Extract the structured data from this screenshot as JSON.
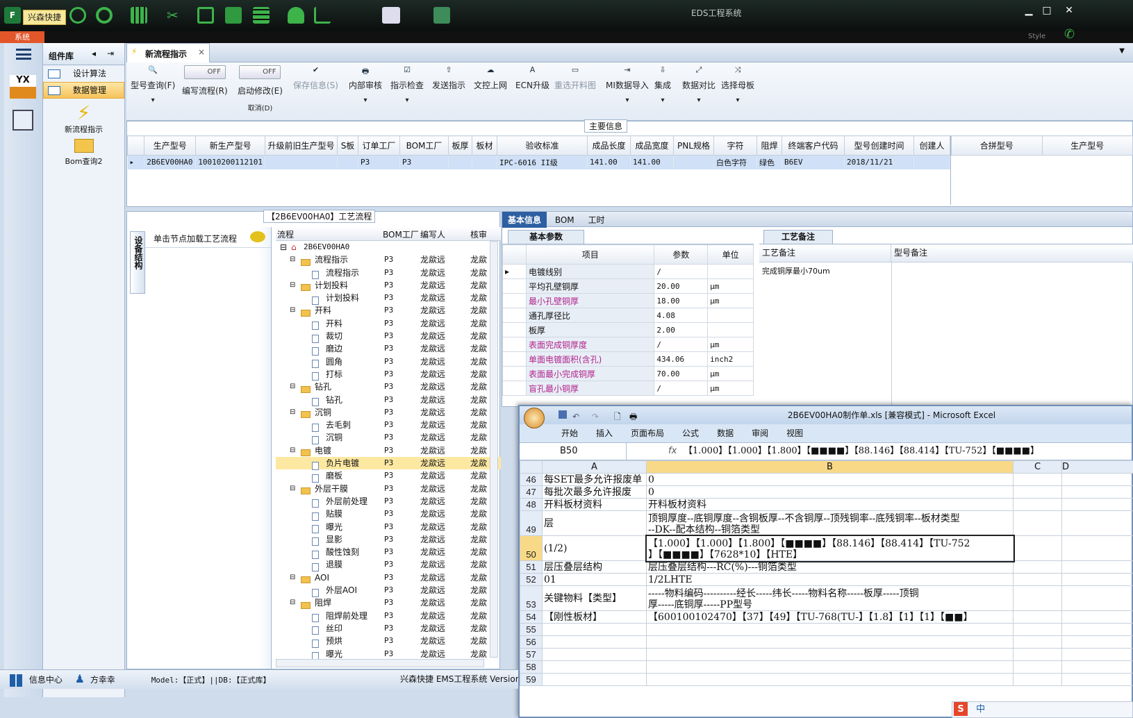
{
  "app": {
    "quick_label": "兴森快捷",
    "title": "EDS工程系统",
    "sys_tab": "系统",
    "style_label": "Style"
  },
  "complib": {
    "title": "组件库",
    "items": [
      {
        "label": "设计算法"
      },
      {
        "label": "数据管理"
      }
    ],
    "big": [
      {
        "label": "新流程指示"
      },
      {
        "label": "Bom查询2"
      }
    ]
  },
  "nav": {
    "yx": "YX"
  },
  "tab": {
    "label": "新流程指示",
    "close": "×"
  },
  "toolbar": {
    "items": [
      {
        "icon": "🔍",
        "label": "型号查询(F)",
        "sub": "▾"
      },
      {
        "label": "编写流程(R)",
        "toggle": "OFF"
      },
      {
        "label": "启动修改(E)",
        "toggle": "OFF",
        "sub": "取消(D)"
      },
      {
        "icon": "✔",
        "label": "保存信息(S)",
        "dis": true
      },
      {
        "icon": "🖶",
        "label": "内部审核",
        "sub": "▾"
      },
      {
        "icon": "☑",
        "label": "指示检查",
        "sub": "▾"
      },
      {
        "icon": "⇧",
        "label": "发送指示"
      },
      {
        "icon": "☁",
        "label": "文控上网"
      },
      {
        "icon": "A",
        "label": "ECN升级"
      },
      {
        "icon": "▭",
        "label": "重选开料图",
        "dis": true
      },
      {
        "icon": "⇥",
        "label": "MI数据导入",
        "sub": "▾"
      },
      {
        "icon": "⇩",
        "label": "集成",
        "sub": "▾"
      },
      {
        "icon": "⤢",
        "label": "数据对比",
        "sub": "▾"
      },
      {
        "icon": "⤨",
        "label": "选择母板",
        "sub": "▾"
      }
    ]
  },
  "main_info": {
    "title": "主要信息",
    "columns": [
      "生产型号",
      "新生产型号",
      "升级前旧生产型号",
      "S板",
      "订单工厂",
      "BOM工厂",
      "板厚",
      "板材",
      "验收标准",
      "成品长度",
      "成品宽度",
      "PNL规格",
      "字符",
      "阻焊",
      "终端客户代码",
      "型号创建时间",
      "创建人"
    ],
    "row": [
      "2B6EV00HA0",
      "10010200112101",
      "",
      "",
      "P3",
      "P3",
      "",
      "",
      "IPC-6016 II级",
      "141.00",
      "141.00",
      "",
      "白色字符",
      "绿色",
      "B6EV",
      "2018/11/21",
      ""
    ],
    "side_columns": [
      "合拼型号",
      "生产型号"
    ]
  },
  "process": {
    "title": "【2B6EV00HA0】工艺流程",
    "vtab": "设备结构",
    "hint": "单击节点加载工艺流程",
    "cols": [
      "流程",
      "BOM工厂",
      "编写人",
      "核审"
    ],
    "root": "2B6EV00HA0",
    "rows": [
      {
        "n": "流程指示",
        "l": 1,
        "f": true,
        "b": "P3",
        "w": "龙歘远",
        "h": "龙歘"
      },
      {
        "n": "流程指示",
        "l": 2,
        "b": "P3",
        "w": "龙歘远",
        "h": "龙歘"
      },
      {
        "n": "计划投料",
        "l": 1,
        "f": true,
        "b": "P3",
        "w": "龙歘远",
        "h": "龙歘"
      },
      {
        "n": "计划投料",
        "l": 2,
        "b": "P3",
        "w": "龙歘远",
        "h": "龙歘"
      },
      {
        "n": "开料",
        "l": 1,
        "f": true,
        "b": "P3",
        "w": "龙歘远",
        "h": "龙歘"
      },
      {
        "n": "开料",
        "l": 2,
        "b": "P3",
        "w": "龙歘远",
        "h": "龙歘"
      },
      {
        "n": "裁切",
        "l": 2,
        "b": "P3",
        "w": "龙歘远",
        "h": "龙歘"
      },
      {
        "n": "磨边",
        "l": 2,
        "b": "P3",
        "w": "龙歘远",
        "h": "龙歘"
      },
      {
        "n": "圆角",
        "l": 2,
        "b": "P3",
        "w": "龙歘远",
        "h": "龙歘"
      },
      {
        "n": "打标",
        "l": 2,
        "b": "P3",
        "w": "龙歘远",
        "h": "龙歘"
      },
      {
        "n": "钻孔",
        "l": 1,
        "f": true,
        "b": "P3",
        "w": "龙歘远",
        "h": "龙歘"
      },
      {
        "n": "钻孔",
        "l": 2,
        "b": "P3",
        "w": "龙歘远",
        "h": "龙歘"
      },
      {
        "n": "沉铜",
        "l": 1,
        "f": true,
        "b": "P3",
        "w": "龙歘远",
        "h": "龙歘"
      },
      {
        "n": "去毛刺",
        "l": 2,
        "b": "P3",
        "w": "龙歘远",
        "h": "龙歘"
      },
      {
        "n": "沉铜",
        "l": 2,
        "b": "P3",
        "w": "龙歘远",
        "h": "龙歘"
      },
      {
        "n": "电镀",
        "l": 1,
        "f": true,
        "b": "P3",
        "w": "龙歘远",
        "h": "龙歘"
      },
      {
        "n": "负片电镀",
        "l": 2,
        "b": "P3",
        "w": "龙歘远",
        "h": "龙歘",
        "sel": true
      },
      {
        "n": "磨板",
        "l": 2,
        "b": "P3",
        "w": "龙歘远",
        "h": "龙歘"
      },
      {
        "n": "外层干膜",
        "l": 1,
        "f": true,
        "b": "P3",
        "w": "龙歘远",
        "h": "龙歘"
      },
      {
        "n": "外层前处理",
        "l": 2,
        "b": "P3",
        "w": "龙歘远",
        "h": "龙歘"
      },
      {
        "n": "贴膜",
        "l": 2,
        "b": "P3",
        "w": "龙歘远",
        "h": "龙歘"
      },
      {
        "n": "曝光",
        "l": 2,
        "b": "P3",
        "w": "龙歘远",
        "h": "龙歘"
      },
      {
        "n": "显影",
        "l": 2,
        "b": "P3",
        "w": "龙歘远",
        "h": "龙歘"
      },
      {
        "n": "酸性蚀刻",
        "l": 2,
        "b": "P3",
        "w": "龙歘远",
        "h": "龙歘"
      },
      {
        "n": "退膜",
        "l": 2,
        "b": "P3",
        "w": "龙歘远",
        "h": "龙歘"
      },
      {
        "n": "AOI",
        "l": 1,
        "f": true,
        "b": "P3",
        "w": "龙歘远",
        "h": "龙歘"
      },
      {
        "n": "外层AOI",
        "l": 2,
        "b": "P3",
        "w": "龙歘远",
        "h": "龙歘"
      },
      {
        "n": "阻焊",
        "l": 1,
        "f": true,
        "b": "P3",
        "w": "龙歘远",
        "h": "龙歘"
      },
      {
        "n": "阻焊前处理",
        "l": 2,
        "b": "P3",
        "w": "龙歘远",
        "h": "龙歘"
      },
      {
        "n": "丝印",
        "l": 2,
        "b": "P3",
        "w": "龙歘远",
        "h": "龙歘"
      },
      {
        "n": "预烘",
        "l": 2,
        "b": "P3",
        "w": "龙歘远",
        "h": "龙歘"
      },
      {
        "n": "曝光",
        "l": 2,
        "b": "P3",
        "w": "龙歘远",
        "h": "龙歘"
      }
    ]
  },
  "basic": {
    "tabs": [
      "基本信息",
      "BOM",
      "工时"
    ],
    "sub": "基本参数",
    "notes_tab": "工艺备注",
    "cols": [
      "项目",
      "参数",
      "单位"
    ],
    "rows": [
      {
        "k": "电镀线别",
        "v": "/",
        "u": "",
        "pink": false
      },
      {
        "k": "平均孔壁铜厚",
        "v": "20.00",
        "u": "μm",
        "pink": false
      },
      {
        "k": "最小孔壁铜厚",
        "v": "18.00",
        "u": "μm",
        "pink": true
      },
      {
        "k": "通孔厚径比",
        "v": "4.08",
        "u": "",
        "pink": false
      },
      {
        "k": "板厚",
        "v": "2.00",
        "u": "",
        "pink": false
      },
      {
        "k": "表面完成铜厚度",
        "v": "/",
        "u": "μm",
        "pink": true
      },
      {
        "k": "单面电镀面积(含孔)",
        "v": "434.06",
        "u": "inch2",
        "pink": true
      },
      {
        "k": "表面最小完成铜厚",
        "v": "70.00",
        "u": "μm",
        "pink": true
      },
      {
        "k": "盲孔最小铜厚",
        "v": "/",
        "u": "μm",
        "pink": true
      }
    ],
    "notes_cols": [
      "工艺备注",
      "型号备注"
    ],
    "note_text": "完成铜厚最小70um"
  },
  "excel": {
    "title": "2B6EV00HA0制作单.xls [兼容模式] - Microsoft Excel",
    "ribbon": [
      "开始",
      "插入",
      "页面布局",
      "公式",
      "数据",
      "审阅",
      "视图"
    ],
    "namebox": "B50",
    "fx": "fx",
    "formula": "【1.000】【1.000】【1.800】【■■■■】【88.146】【88.414】【TU-752】【■■■■】",
    "cols": [
      "A",
      "B",
      "C",
      "D"
    ],
    "rows": [
      {
        "r": "46",
        "a": "每SET最多允许报废单",
        "b": "0"
      },
      {
        "r": "47",
        "a": "每批次最多允许报废",
        "b": "0"
      },
      {
        "r": "48",
        "a": "开料板材资料",
        "b": "开料板材资料"
      },
      {
        "r": "49",
        "a": "层",
        "b": "顶铜厚度--底铜厚度--含铜板厚--不含铜厚--顶残铜率--底残铜率--板材类型",
        "b2": "--DK--配本结构--铜箔类型"
      },
      {
        "r": "50",
        "a": "(1/2)",
        "b": "【1.000】【1.000】【1.800】【■■■■】【88.146】【88.414】【TU-752",
        "b2": "】【■■■■】【7628*10】【HTE】",
        "sel": true
      },
      {
        "r": "51",
        "a": "层压叠层结构",
        "b": "层压叠层结构---RC(%)---铜箔类型"
      },
      {
        "r": "52",
        "a": "01",
        "b": "1/2LHTE"
      },
      {
        "r": "53",
        "a": "关键物料【类型】",
        "b": "-----物料编码----------经长-----纬长-----物料名称-----板厚-----顶铜",
        "b2": "厚-----底铜厚-----PP型号"
      },
      {
        "r": "54",
        "a": "【刚性板材】",
        "b": "【600100102470】【37】【49】【TU-768(TU-】【1.8】【1】【1】【■■】"
      },
      {
        "r": "55",
        "a": "",
        "b": ""
      },
      {
        "r": "56",
        "a": "",
        "b": ""
      },
      {
        "r": "57",
        "a": "",
        "b": ""
      },
      {
        "r": "58",
        "a": "",
        "b": ""
      },
      {
        "r": "59",
        "a": "",
        "b": ""
      }
    ]
  },
  "status": {
    "info": "信息中心",
    "user": "方幸幸",
    "model": "Model:【正式】||DB:【正式库】",
    "company": "兴森快捷 EMS工程系统 Version"
  },
  "ime": {
    "label": "中"
  }
}
